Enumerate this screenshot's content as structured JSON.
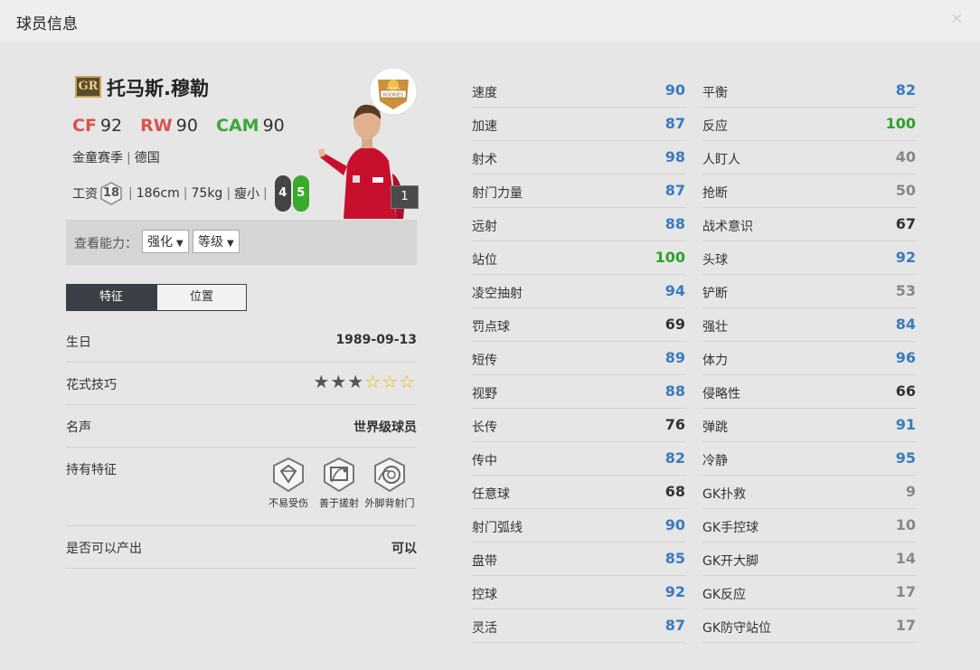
{
  "window": {
    "title": "球员信息",
    "close_glyph": "×"
  },
  "player": {
    "season_badge": "GR",
    "name": "托马斯.穆勒",
    "positions": [
      {
        "pos": "CF",
        "value": "92",
        "color": "#d9534f"
      },
      {
        "pos": "RW",
        "value": "90",
        "color": "#d9534f"
      },
      {
        "pos": "CAM",
        "value": "90",
        "color": "#3aa83a"
      }
    ],
    "season": "金童赛季",
    "nation": "德国",
    "wage_label": "工资",
    "wage": "18",
    "height": "186cm",
    "weight": "75kg",
    "build": "瘦小",
    "weak_foot": "4",
    "strong_foot": "5",
    "card_badge": "1",
    "rookies_badge_text": [
      "GOLDEN",
      "ROOKIES"
    ]
  },
  "filter": {
    "label": "查看能力：",
    "select1": "强化",
    "select2": "等级"
  },
  "tabs": {
    "features": "特征",
    "position": "位置"
  },
  "details": {
    "birthday_label": "生日",
    "birthday": "1989-09-13",
    "skill_label": "花式技巧",
    "skill_stars": 3,
    "fame_label": "名声",
    "fame": "世界级球员",
    "traits_label": "持有特征",
    "traits": [
      "不易受伤",
      "善于搓射",
      "外脚背射门"
    ],
    "output_label": "是否可以产出",
    "output": "可以"
  },
  "stats_left": [
    {
      "name": "速度",
      "value": "90",
      "color": "blue"
    },
    {
      "name": "加速",
      "value": "87",
      "color": "blue"
    },
    {
      "name": "射术",
      "value": "98",
      "color": "blue"
    },
    {
      "name": "射门力量",
      "value": "87",
      "color": "blue"
    },
    {
      "name": "远射",
      "value": "88",
      "color": "blue"
    },
    {
      "name": "站位",
      "value": "100",
      "color": "green"
    },
    {
      "name": "凌空抽射",
      "value": "94",
      "color": "blue"
    },
    {
      "name": "罚点球",
      "value": "69",
      "color": "dark"
    },
    {
      "name": "短传",
      "value": "89",
      "color": "blue"
    },
    {
      "name": "视野",
      "value": "88",
      "color": "blue"
    },
    {
      "name": "长传",
      "value": "76",
      "color": "dark"
    },
    {
      "name": "传中",
      "value": "82",
      "color": "blue"
    },
    {
      "name": "任意球",
      "value": "68",
      "color": "dark"
    },
    {
      "name": "射门弧线",
      "value": "90",
      "color": "blue"
    },
    {
      "name": "盘带",
      "value": "85",
      "color": "blue"
    },
    {
      "name": "控球",
      "value": "92",
      "color": "blue"
    },
    {
      "name": "灵活",
      "value": "87",
      "color": "blue"
    }
  ],
  "stats_right": [
    {
      "name": "平衡",
      "value": "82",
      "color": "blue"
    },
    {
      "name": "反应",
      "value": "100",
      "color": "green"
    },
    {
      "name": "人盯人",
      "value": "40",
      "color": "gray"
    },
    {
      "name": "抢断",
      "value": "50",
      "color": "gray"
    },
    {
      "name": "战术意识",
      "value": "67",
      "color": "dark"
    },
    {
      "name": "头球",
      "value": "92",
      "color": "blue"
    },
    {
      "name": "铲断",
      "value": "53",
      "color": "gray"
    },
    {
      "name": "强壮",
      "value": "84",
      "color": "blue"
    },
    {
      "name": "体力",
      "value": "96",
      "color": "blue"
    },
    {
      "name": "侵略性",
      "value": "66",
      "color": "dark"
    },
    {
      "name": "弹跳",
      "value": "91",
      "color": "blue"
    },
    {
      "name": "冷静",
      "value": "95",
      "color": "blue"
    },
    {
      "name": "GK扑救",
      "value": "9",
      "color": "gray"
    },
    {
      "name": "GK手控球",
      "value": "10",
      "color": "gray"
    },
    {
      "name": "GK开大脚",
      "value": "14",
      "color": "gray"
    },
    {
      "name": "GK反应",
      "value": "17",
      "color": "gray"
    },
    {
      "name": "GK防守站位",
      "value": "17",
      "color": "gray"
    }
  ]
}
